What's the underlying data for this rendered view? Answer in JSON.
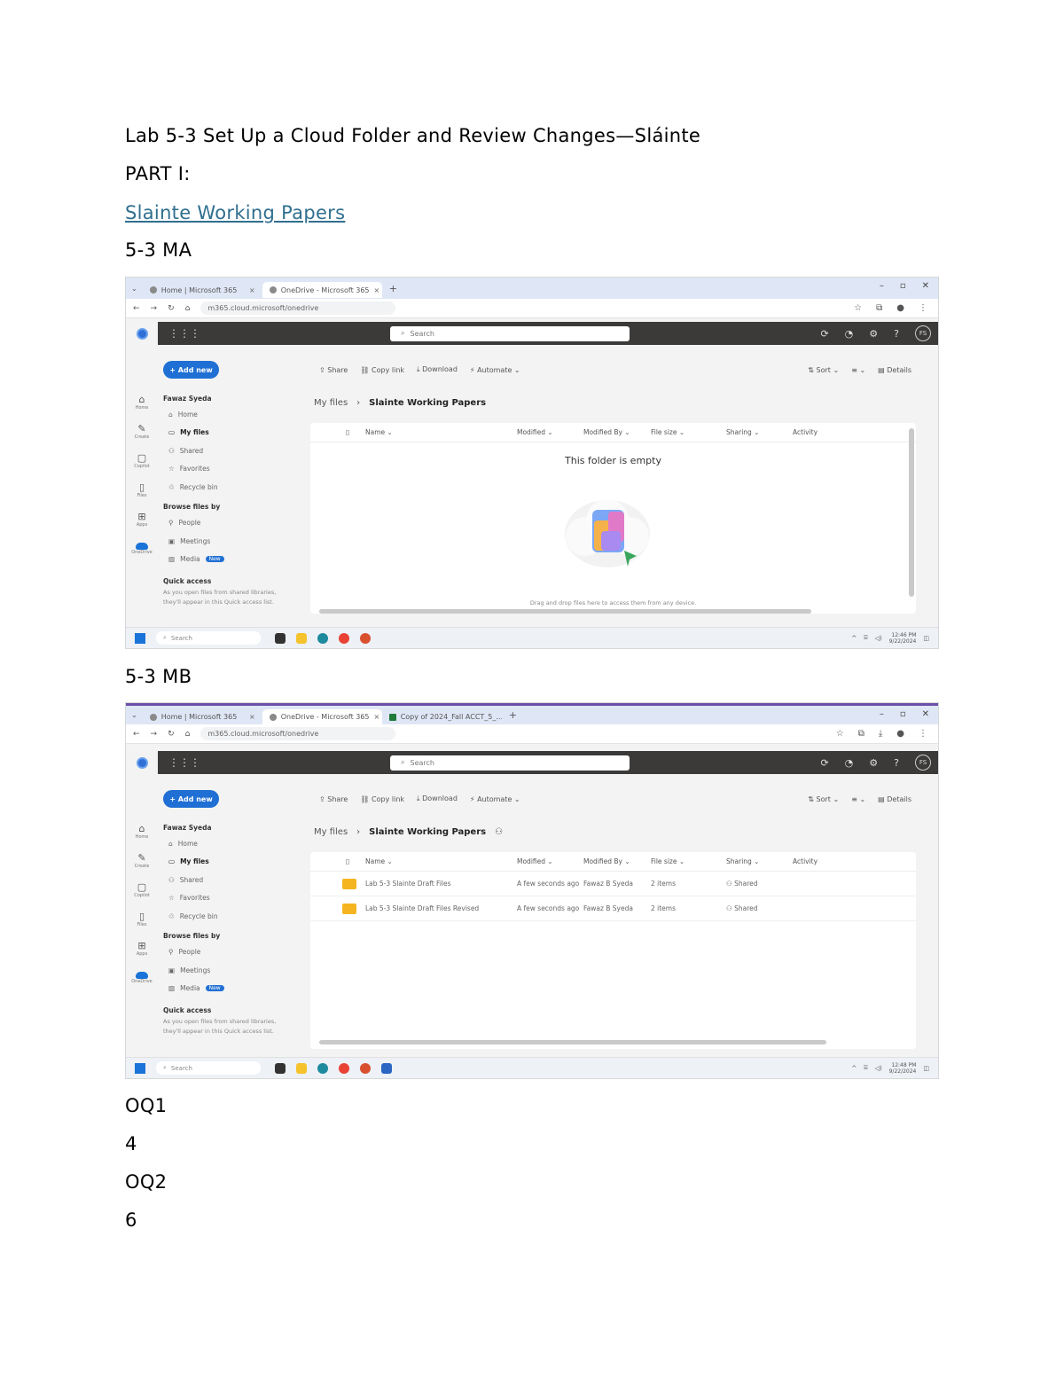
{
  "doc": {
    "title": "Lab 5-3   Set Up a Cloud Folder and Review Changes—Sláinte",
    "part": "PART I:",
    "link": "Slainte Working Papers",
    "label_ma": "5-3 MA",
    "label_mb": "5-3 MB",
    "oq1": "OQ1",
    "oq1_answer": "4",
    "oq2": "OQ2",
    "oq2_answer": "6"
  },
  "shot_ma": {
    "tabs": [
      "Home | Microsoft 365",
      "OneDrive - Microsoft 365"
    ],
    "url": "m365.cloud.microsoft/onedrive",
    "search": "Search",
    "add_new": "+ Add new",
    "user": "Fawaz Syeda",
    "nav": [
      "Home",
      "My files",
      "Shared",
      "Favorites",
      "Recycle bin"
    ],
    "browse_head": "Browse files by",
    "browse": [
      "People",
      "Meetings",
      "Media"
    ],
    "new_badge": "New",
    "quick_head": "Quick access",
    "quick_text": "As you open files from shared libraries, they'll appear in this Quick access list.",
    "commands": [
      "Share",
      "Copy link",
      "Download",
      "Automate"
    ],
    "cmd_right": [
      "Sort",
      "Details"
    ],
    "crumb_root": "My files",
    "crumb_folder": "Slainte Working Papers",
    "columns": [
      "Name",
      "Modified",
      "Modified By",
      "File size",
      "Sharing",
      "Activity"
    ],
    "empty_title": "This folder is empty",
    "empty_hint": "Drag and drop files here to access them from any device.",
    "taskbar_search": "Search",
    "clock_time": "12:46 PM",
    "clock_date": "9/22/2024"
  },
  "shot_mb": {
    "tabs": [
      "Home | Microsoft 365",
      "OneDrive - Microsoft 365",
      "Copy of 2024_Fall ACCT_5_..."
    ],
    "url": "m365.cloud.microsoft/onedrive",
    "search": "Search",
    "add_new": "+ Add new",
    "user": "Fawaz Syeda",
    "nav": [
      "Home",
      "My files",
      "Shared",
      "Favorites",
      "Recycle bin"
    ],
    "browse_head": "Browse files by",
    "browse": [
      "People",
      "Meetings",
      "Media"
    ],
    "new_badge": "New",
    "quick_head": "Quick access",
    "quick_text": "As you open files from shared libraries, they'll appear in this Quick access list.",
    "commands": [
      "Share",
      "Copy link",
      "Download",
      "Automate"
    ],
    "cmd_right": [
      "Sort",
      "Details"
    ],
    "crumb_root": "My files",
    "crumb_folder": "Slainte Working Papers",
    "columns": [
      "Name",
      "Modified",
      "Modified By",
      "File size",
      "Sharing",
      "Activity"
    ],
    "rows": [
      {
        "name": "Lab 5-3 Slainte Draft Files",
        "modified": "A few seconds ago",
        "by": "Fawaz B Syeda",
        "size": "2 items",
        "sharing": "Shared"
      },
      {
        "name": "Lab 5-3 Slainte Draft Files Revised",
        "modified": "A few seconds ago",
        "by": "Fawaz B Syeda",
        "size": "2 items",
        "sharing": "Shared"
      }
    ],
    "taskbar_search": "Search",
    "clock_time": "12:48 PM",
    "clock_date": "9/22/2024"
  },
  "colors": {
    "link": "#2f6f8f",
    "accent": "#1f6fd4",
    "folder": "#f5b521",
    "appbar": "#3b3a39"
  }
}
